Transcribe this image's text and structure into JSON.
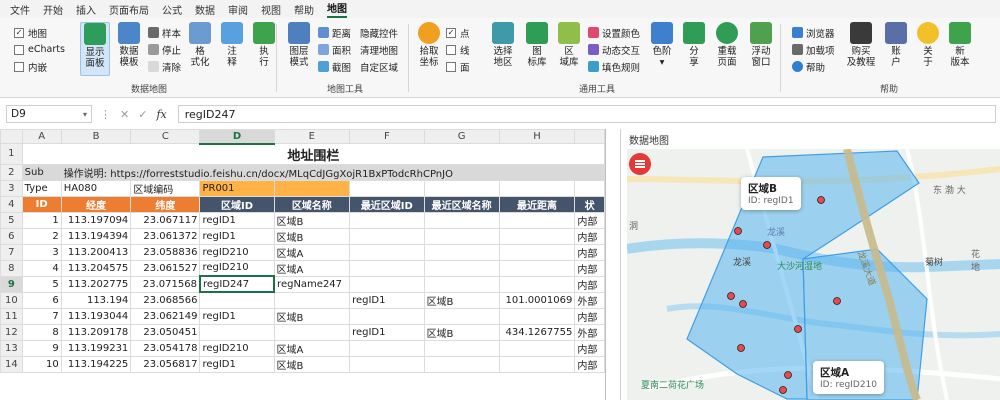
{
  "menu": [
    "文件",
    "开始",
    "插入",
    "页面布局",
    "公式",
    "数据",
    "审阅",
    "视图",
    "帮助",
    "地图"
  ],
  "ribbon": {
    "checks": [
      {
        "label": "地图",
        "checked": true
      },
      {
        "label": "eCharts",
        "checked": false
      },
      {
        "label": "内嵌",
        "checked": false
      }
    ],
    "big1": [
      {
        "label": "显示\n面板"
      },
      {
        "label": "数据\n模板"
      }
    ],
    "small1": [
      "样本",
      "停止",
      "清除"
    ],
    "big2": [
      {
        "label": "格\n式化"
      },
      {
        "label": "注\n释"
      },
      {
        "label": "执\n行"
      }
    ],
    "group1": "数据地图",
    "big3": [
      {
        "label": "图层\n模式"
      }
    ],
    "small2": [
      "距离",
      "面积",
      "截图"
    ],
    "small3": [
      "隐藏控件",
      "清理地图",
      "自定区域"
    ],
    "group2": "地图工具",
    "big4": [
      {
        "label": "拾取\n坐标"
      }
    ],
    "checks2": [
      {
        "label": "点",
        "checked": true
      },
      {
        "label": "线",
        "checked": false
      },
      {
        "label": "面",
        "checked": false
      }
    ],
    "big5": [
      {
        "label": "选择\n地区"
      },
      {
        "label": "图\n标库"
      },
      {
        "label": "区\n域库"
      }
    ],
    "small4": [
      "设置颜色",
      "动态交互",
      "填色规则"
    ],
    "big6": [
      {
        "label": "色阶\n▾"
      },
      {
        "label": "分\n享"
      },
      {
        "label": "重载\n页面"
      },
      {
        "label": "浮动\n窗口"
      }
    ],
    "group3": "通用工具",
    "small5": [
      "浏览器",
      "加载项",
      "帮助"
    ],
    "big7": [
      {
        "label": "购买\n及教程"
      },
      {
        "label": "账\n户"
      },
      {
        "label": "关\n于"
      },
      {
        "label": "新\n版本"
      }
    ],
    "group4": "帮助"
  },
  "formula": {
    "cell": "D9",
    "value": "regID247",
    "fx": "fx"
  },
  "sheet": {
    "cols": [
      "A",
      "B",
      "C",
      "D",
      "E",
      "F",
      "G",
      "H",
      ""
    ],
    "title": "地址围栏",
    "sub_label": "Sub",
    "sub_text": "操作说明:  https://forreststudio.feishu.cn/docx/MLqCdJGgXojR1BxPTodcRhCPnJO",
    "type_label": "Type",
    "type_value": "HA080",
    "code_label": "区域编码",
    "code_value": "PR001",
    "headers": [
      "ID",
      "经度",
      "纬度",
      "区域ID",
      "区域名称",
      "最近区域ID",
      "最近区域名称",
      "最近距离",
      "状"
    ],
    "rows": [
      [
        "1",
        "113.197094",
        "23.067117",
        "regID1",
        "区域B",
        "",
        "",
        "",
        "内部"
      ],
      [
        "2",
        "113.194394",
        "23.061372",
        "regID1",
        "区域B",
        "",
        "",
        "",
        "内部"
      ],
      [
        "3",
        "113.200413",
        "23.058836",
        "regID210",
        "区域A",
        "",
        "",
        "",
        "内部"
      ],
      [
        "4",
        "113.204575",
        "23.061527",
        "regID210",
        "区域A",
        "",
        "",
        "",
        "内部"
      ],
      [
        "5",
        "113.202775",
        "23.071568",
        "regID247",
        "regName247",
        "",
        "",
        "",
        "内部"
      ],
      [
        "6",
        "113.194",
        "23.068566",
        "",
        "",
        "regID1",
        "区域B",
        "101.0001069",
        "外部"
      ],
      [
        "7",
        "113.193044",
        "23.062149",
        "regID1",
        "区域B",
        "",
        "",
        "",
        "内部"
      ],
      [
        "8",
        "113.209178",
        "23.050451",
        "",
        "",
        "regID1",
        "区域B",
        "434.1267755",
        "外部"
      ],
      [
        "9",
        "113.199231",
        "23.054178",
        "regID210",
        "区域A",
        "",
        "",
        "",
        "内部"
      ],
      [
        "10",
        "113.194225",
        "23.056817",
        "regID1",
        "区域B",
        "",
        "",
        "",
        "内部"
      ]
    ]
  },
  "map": {
    "title": "数据地图",
    "tipB": {
      "name": "区域B",
      "id": "ID: regID1"
    },
    "tipA": {
      "name": "区域A",
      "id": "ID: regID210"
    },
    "labels": [
      "东 渤 大",
      "龙溪",
      "大沙河湿地",
      "菊树",
      "龙溪",
      "花 地",
      "洞",
      "夏南二荷花广场",
      "龙溪大道"
    ],
    "colors": {
      "region": "#5ab4f0",
      "point": "#e84a4a",
      "road": "#c9b98a"
    }
  }
}
